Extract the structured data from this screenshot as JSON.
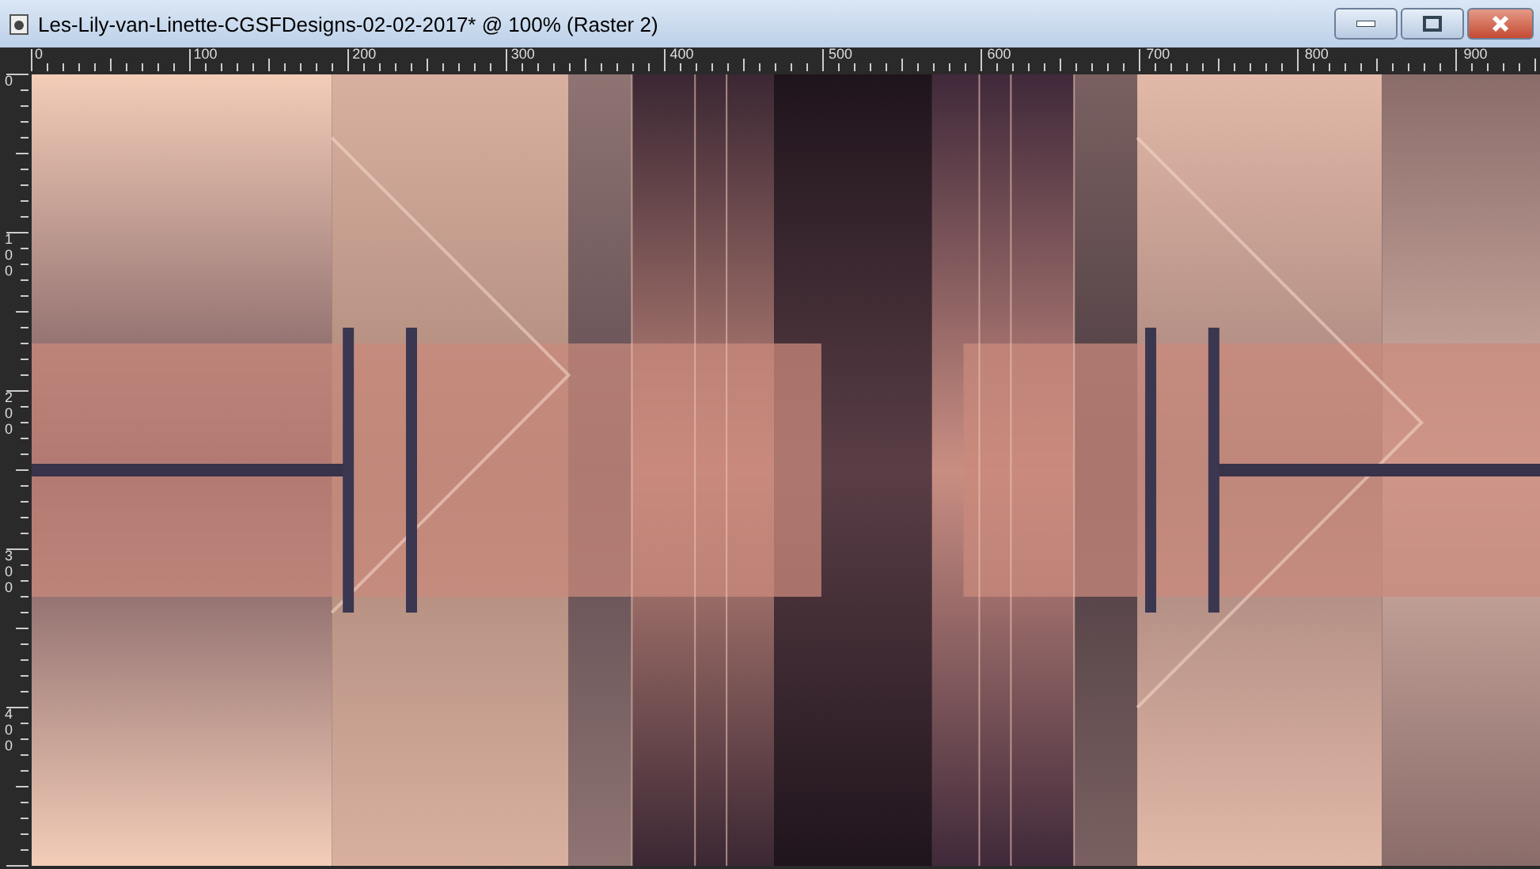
{
  "window": {
    "title": "Les-Lily-van-Linette-CGSFDesigns-02-02-2017* @ 100% (Raster 2)"
  },
  "top_ruler": {
    "labels": [
      "0",
      "100",
      "200",
      "300",
      "400",
      "500",
      "600",
      "700",
      "800",
      "900"
    ]
  },
  "left_ruler": {
    "labels": [
      "0",
      "100",
      "200",
      "300",
      "400"
    ]
  }
}
